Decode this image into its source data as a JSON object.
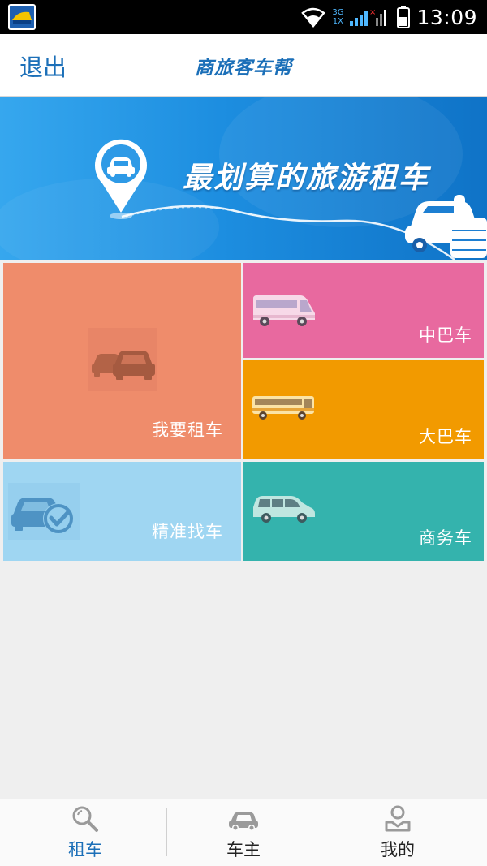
{
  "status_bar": {
    "time": "13:09",
    "network_top": "3G",
    "network_bottom": "1X"
  },
  "header": {
    "back_label": "退出",
    "title": "商旅客车帮"
  },
  "banner": {
    "slogan": "最划算的旅游租车"
  },
  "tiles": {
    "rent": "我要租车",
    "minibus": "中巴车",
    "bus": "大巴车",
    "find": "精准找车",
    "business": "商务车"
  },
  "bottom_nav": {
    "items": [
      {
        "label": "租车",
        "active": true
      },
      {
        "label": "车主",
        "active": false
      },
      {
        "label": "我的",
        "active": false
      }
    ]
  },
  "colors": {
    "accent": "#1b6fb8",
    "rent": "#ef8c6b",
    "minibus": "#e8699f",
    "bus": "#f29a00",
    "find": "#9fd6f2",
    "business": "#34b3ad"
  }
}
